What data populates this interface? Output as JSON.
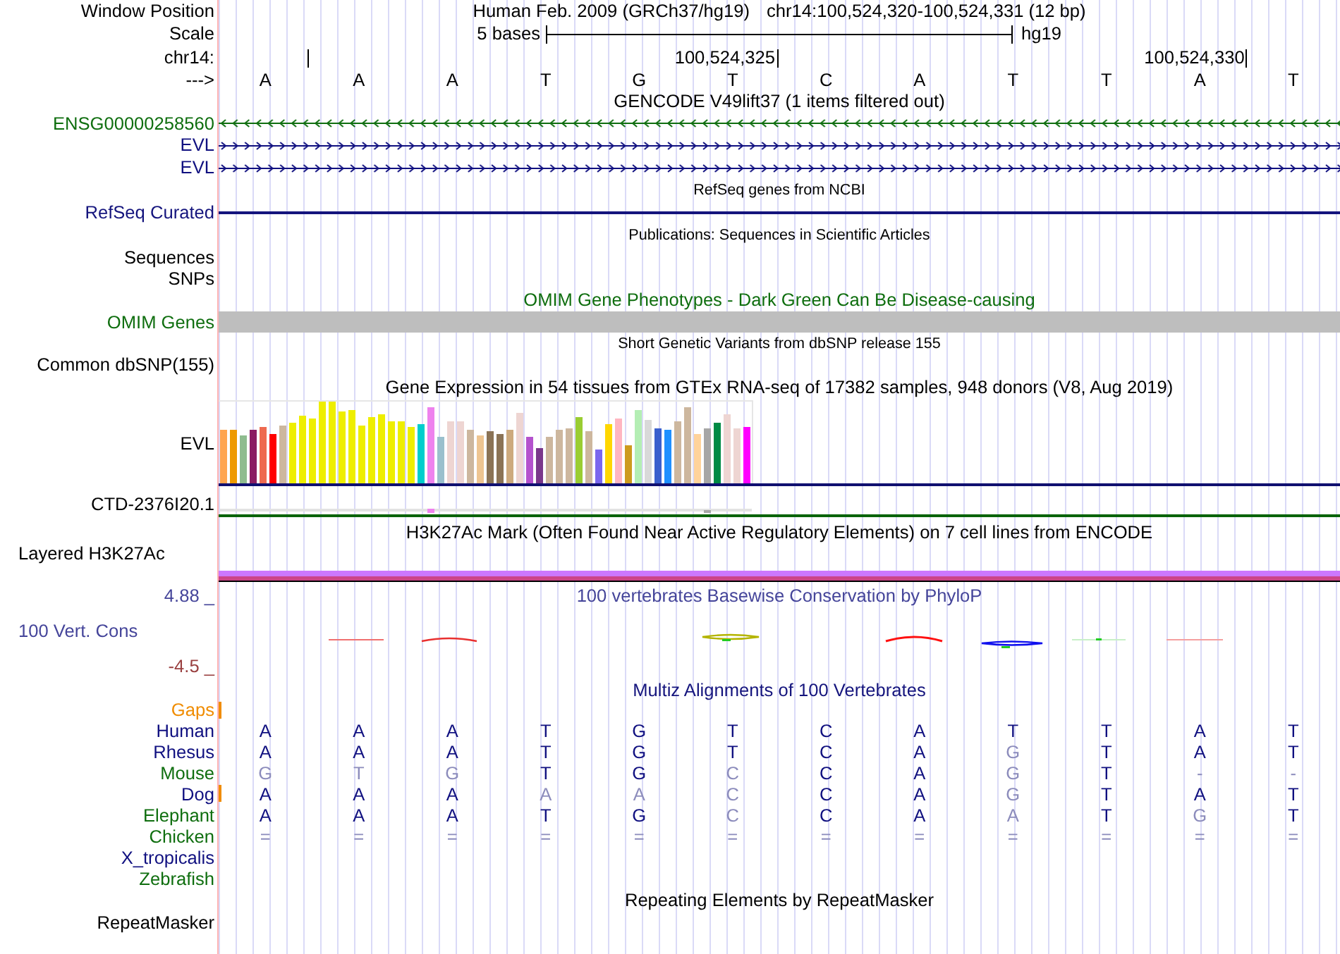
{
  "header": {
    "label": "Window Position",
    "assembly": "Human Feb. 2009 (GRCh37/hg19)",
    "position": "chr14:100,524,320-100,524,331 (12 bp)"
  },
  "scale": {
    "label": "Scale",
    "length": "5 bases",
    "assembly": "hg19"
  },
  "coordinates": {
    "label": "chr14:",
    "first_tick": true,
    "ticks": [
      {
        "label": "100,524,325"
      },
      {
        "label": "100,524,330"
      }
    ]
  },
  "sequence": {
    "label": "--->",
    "bases": [
      "A",
      "A",
      "A",
      "T",
      "G",
      "T",
      "C",
      "A",
      "T",
      "T",
      "A",
      "T"
    ]
  },
  "gencode": {
    "title": "GENCODE V49lift37 (1 items filtered out)",
    "genes": [
      {
        "name": "ENSG00000258560",
        "reverse": true,
        "color": "#0f6e0f"
      },
      {
        "name": "EVL",
        "reverse": false,
        "color": "#101080"
      },
      {
        "name": "EVL",
        "reverse": false,
        "color": "#101080"
      }
    ]
  },
  "refseq": {
    "title": "RefSeq genes from NCBI",
    "label": "RefSeq Curated"
  },
  "publications": {
    "title": "Publications: Sequences in Scientific Articles",
    "labels": [
      "Sequences",
      "SNPs"
    ]
  },
  "omim": {
    "title": "OMIM Gene Phenotypes - Dark Green Can Be Disease-causing",
    "label": "OMIM Genes"
  },
  "dbsnp": {
    "title": "Short Genetic Variants from dbSNP release 155",
    "label": "Common dbSNP(155)"
  },
  "gtex": {
    "title": "Gene Expression in 54 tissues from GTEx RNA-seq of 17382 samples, 948 donors (V8, Aug 2019)",
    "genes": [
      "EVL",
      "CTD-2376I20.1"
    ]
  },
  "h3k27ac": {
    "title": "H3K27Ac Mark (Often Found Near Active Regulatory Elements) on 7 cell lines from ENCODE",
    "label": "Layered H3K27Ac"
  },
  "phylop": {
    "title": "100 vertebrates Basewise Conservation by PhyloP",
    "label": "100 Vert. Cons",
    "max": "4.88 _",
    "min": "-4.5 _"
  },
  "multiz": {
    "title": "Multiz Alignments of 100 Vertebrates",
    "gaps": {
      "label": "Gaps",
      "insertion": true
    },
    "species": [
      {
        "name": "Human",
        "color": "#101080",
        "insertion": false,
        "bases": [
          {
            "base": "A",
            "matches": true
          },
          {
            "base": "A",
            "matches": true
          },
          {
            "base": "A",
            "matches": true
          },
          {
            "base": "T",
            "matches": true
          },
          {
            "base": "G",
            "matches": true
          },
          {
            "base": "T",
            "matches": true
          },
          {
            "base": "C",
            "matches": true
          },
          {
            "base": "A",
            "matches": true
          },
          {
            "base": "T",
            "matches": true
          },
          {
            "base": "T",
            "matches": true
          },
          {
            "base": "A",
            "matches": true
          },
          {
            "base": "T",
            "matches": true
          }
        ]
      },
      {
        "name": "Rhesus",
        "color": "#101080",
        "insertion": false,
        "bases": [
          {
            "base": "A",
            "matches": true
          },
          {
            "base": "A",
            "matches": true
          },
          {
            "base": "A",
            "matches": true
          },
          {
            "base": "T",
            "matches": true
          },
          {
            "base": "G",
            "matches": true
          },
          {
            "base": "T",
            "matches": true
          },
          {
            "base": "C",
            "matches": true
          },
          {
            "base": "A",
            "matches": true
          },
          {
            "base": "G",
            "matches": false
          },
          {
            "base": "T",
            "matches": true
          },
          {
            "base": "A",
            "matches": true
          },
          {
            "base": "T",
            "matches": true
          }
        ]
      },
      {
        "name": "Mouse",
        "color": "#0f6e0f",
        "insertion": false,
        "bases": [
          {
            "base": "G",
            "matches": false
          },
          {
            "base": "T",
            "matches": false
          },
          {
            "base": "G",
            "matches": false
          },
          {
            "base": "T",
            "matches": true
          },
          {
            "base": "G",
            "matches": true
          },
          {
            "base": "C",
            "matches": false
          },
          {
            "base": "C",
            "matches": true
          },
          {
            "base": "A",
            "matches": true
          },
          {
            "base": "G",
            "matches": false
          },
          {
            "base": "T",
            "matches": true
          },
          {
            "base": "-",
            "matches": false
          },
          {
            "base": "-",
            "matches": false
          }
        ]
      },
      {
        "name": "Dog",
        "color": "#101080",
        "insertion": true,
        "bases": [
          {
            "base": "A",
            "matches": true
          },
          {
            "base": "A",
            "matches": true
          },
          {
            "base": "A",
            "matches": true
          },
          {
            "base": "A",
            "matches": false
          },
          {
            "base": "A",
            "matches": false
          },
          {
            "base": "C",
            "matches": false
          },
          {
            "base": "C",
            "matches": true
          },
          {
            "base": "A",
            "matches": true
          },
          {
            "base": "G",
            "matches": false
          },
          {
            "base": "T",
            "matches": true
          },
          {
            "base": "A",
            "matches": true
          },
          {
            "base": "T",
            "matches": true
          }
        ]
      },
      {
        "name": "Elephant",
        "color": "#0f6e0f",
        "insertion": false,
        "bases": [
          {
            "base": "A",
            "matches": true
          },
          {
            "base": "A",
            "matches": true
          },
          {
            "base": "A",
            "matches": true
          },
          {
            "base": "T",
            "matches": true
          },
          {
            "base": "G",
            "matches": true
          },
          {
            "base": "C",
            "matches": false
          },
          {
            "base": "C",
            "matches": true
          },
          {
            "base": "A",
            "matches": true
          },
          {
            "base": "A",
            "matches": false
          },
          {
            "base": "T",
            "matches": true
          },
          {
            "base": "G",
            "matches": false
          },
          {
            "base": "T",
            "matches": true
          }
        ]
      },
      {
        "name": "Chicken",
        "color": "#0f6e0f",
        "insertion": false,
        "bases": [
          {
            "base": "=",
            "matches": false
          },
          {
            "base": "=",
            "matches": false
          },
          {
            "base": "=",
            "matches": false
          },
          {
            "base": "=",
            "matches": false
          },
          {
            "base": "=",
            "matches": false
          },
          {
            "base": "=",
            "matches": false
          },
          {
            "base": "=",
            "matches": false
          },
          {
            "base": "=",
            "matches": false
          },
          {
            "base": "=",
            "matches": false
          },
          {
            "base": "=",
            "matches": false
          },
          {
            "base": "=",
            "matches": false
          },
          {
            "base": "=",
            "matches": false
          }
        ]
      },
      {
        "name": "X_tropicalis",
        "color": "#101080",
        "insertion": false
      },
      {
        "name": "Zebrafish",
        "color": "#0f6e0f",
        "insertion": false
      }
    ]
  },
  "repeatmasker": {
    "title": "Repeating Elements by RepeatMasker",
    "label": "RepeatMasker"
  }
}
